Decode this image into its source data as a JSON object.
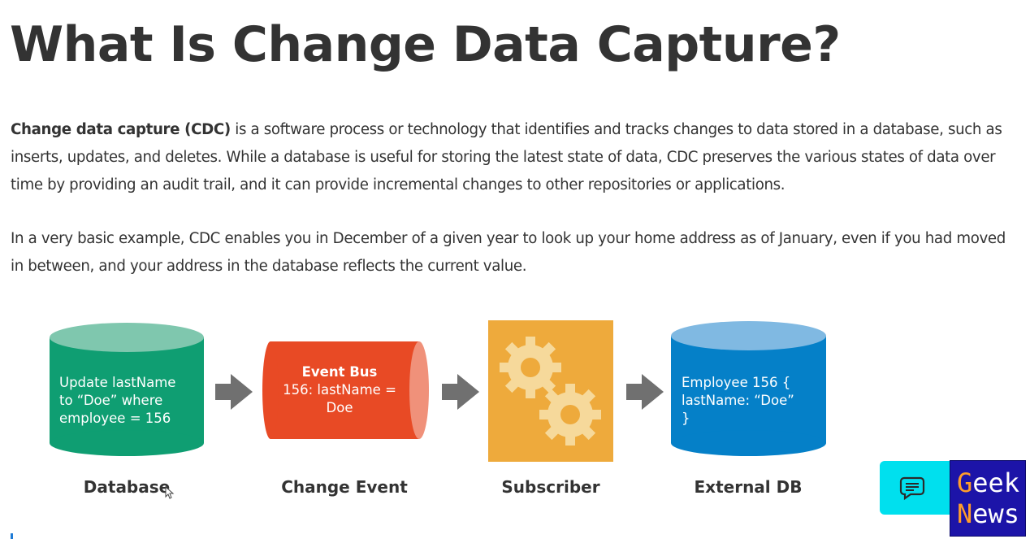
{
  "page": {
    "title": "What Is Change Data Capture?",
    "intro_bold": "Change data capture (CDC)",
    "intro_rest": " is a software process or technology that identifies and tracks changes to data stored in a database, such as inserts, updates, and deletes. While a database is useful for storing the latest state of data, CDC preserves the various states of data over time by providing an audit trail, and it can provide incremental changes to other repositories or applications.",
    "example": "In a very basic example, CDC enables you in December of a given year to look up your home address as of January, even if you had moved in between, and your address in the database reflects the current value."
  },
  "diagram": {
    "nodes": [
      {
        "label": "Database",
        "lines": [
          "Update lastName",
          "to “Doe” where",
          "employee = 156"
        ],
        "color": "#0f9e72",
        "top_color": "#7fc7ae"
      },
      {
        "label": "Change Event",
        "heading": "Event Bus",
        "lines": [
          "156: lastName =",
          "Doe"
        ],
        "color": "#e84a25",
        "cap_color": "#f0917a"
      },
      {
        "label": "Subscriber",
        "color": "#eeaa3c",
        "gear_color": "#f6d99b"
      },
      {
        "label": "External DB",
        "lines": [
          "Employee 156 {",
          "lastName: “Doe”",
          "}"
        ],
        "color": "#0580c8",
        "top_color": "#80b9e2"
      }
    ],
    "arrow_color": "#707070"
  },
  "widgets": {
    "chat_icon": "chat-bubble-icon",
    "chat_color": "#00e0ee",
    "badge_line1_accent": "G",
    "badge_line1_rest": "eek",
    "badge_line2_accent": "N",
    "badge_line2_rest": "ews",
    "badge_color": "#1c14a8",
    "badge_accent_color": "#ff9d2b"
  }
}
